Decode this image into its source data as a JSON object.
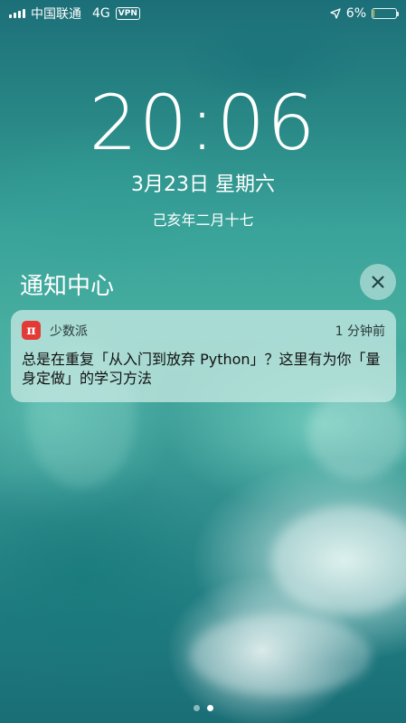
{
  "status_bar": {
    "carrier": "中国联通",
    "network": "4G",
    "vpn": "VPN",
    "battery_percent": "6%",
    "battery_level": 0.06,
    "colors": {
      "battery_low": "#f5d31c"
    }
  },
  "lock_screen": {
    "time": "20:06",
    "date": "3月23日 星期六",
    "lunar_date": "己亥年二月十七"
  },
  "notification_center": {
    "title": "通知中心",
    "close_icon": "close-icon"
  },
  "notification": {
    "app_icon_glyph": "π",
    "app_icon_color": "#e33a36",
    "app_name": "少数派",
    "time_ago": "1 分钟前",
    "body": "总是在重复「从入门到放弃 Python」？这里有为你「量身定做」的学习方法"
  },
  "page_indicator": {
    "pages": 2,
    "active": 1
  }
}
